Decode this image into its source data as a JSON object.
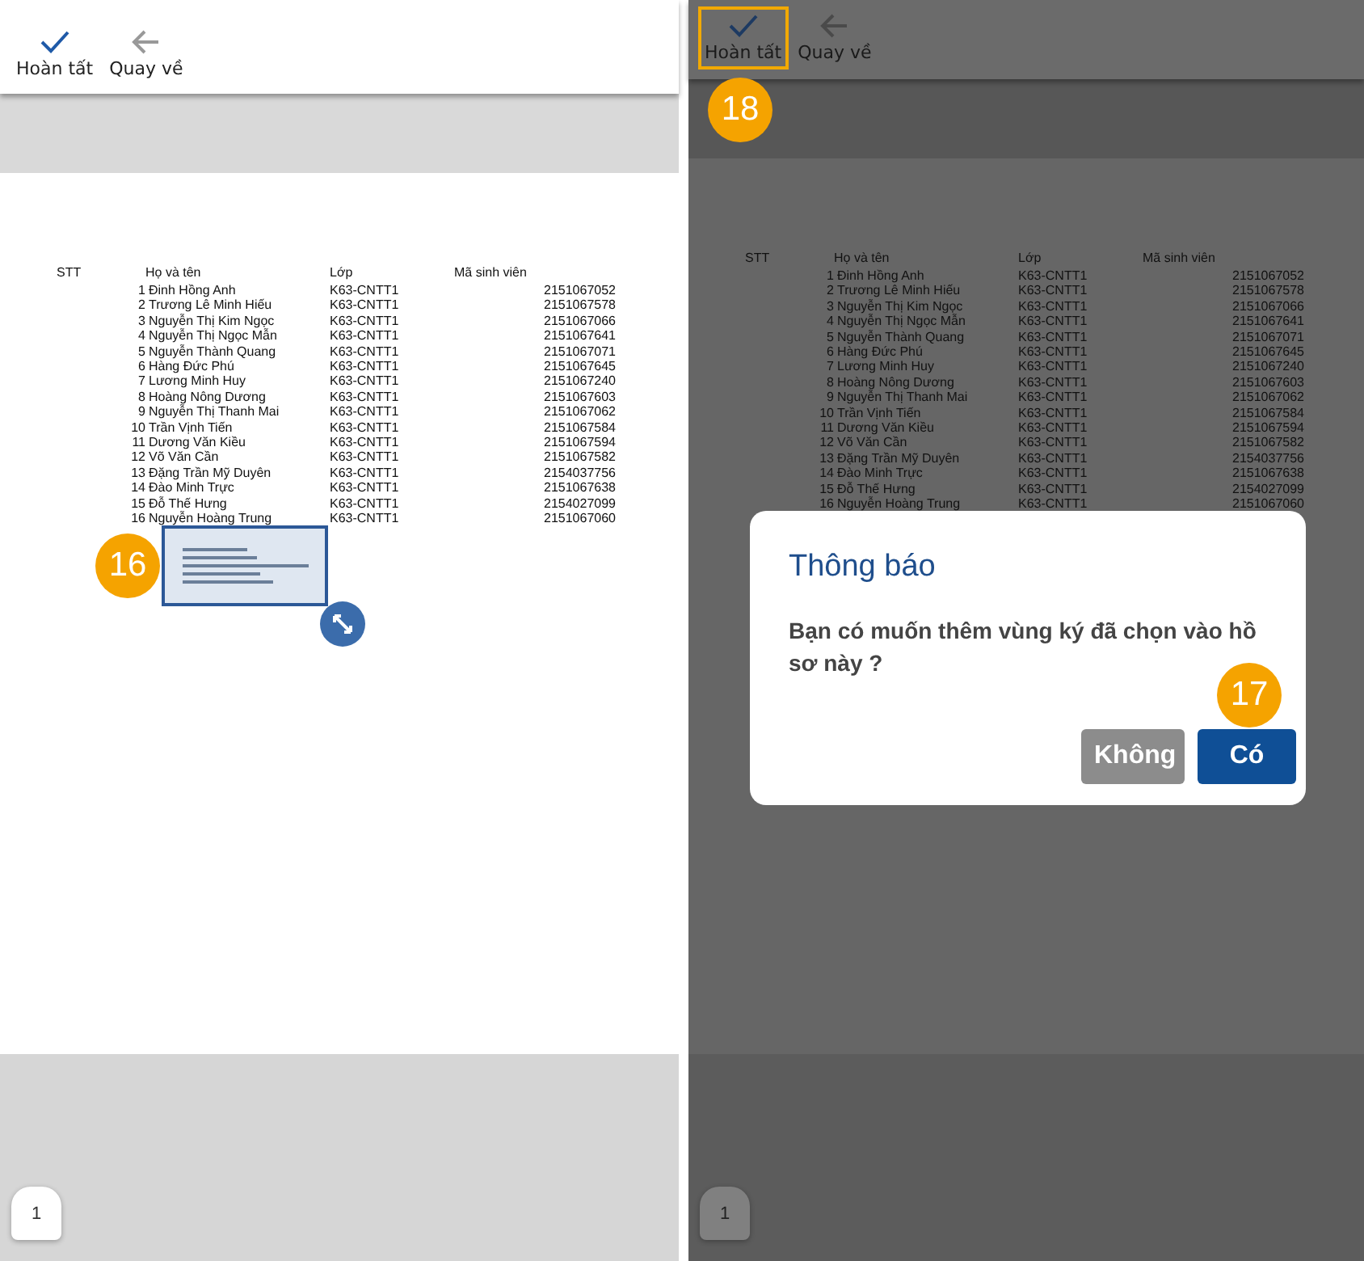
{
  "screens": [
    {
      "dimmed": false,
      "toolbar_buttons": [
        {
          "kind": "done",
          "label": "Hoàn tất",
          "highlighted": false
        },
        {
          "kind": "back",
          "label": "Quay về",
          "highlighted": false
        }
      ],
      "table": {
        "columns": [
          "STT",
          "Họ và tên",
          "Lớp",
          "Mã sinh viên"
        ],
        "rows": [
          {
            "no": "1",
            "name": "Đinh Hồng Anh",
            "class": "K63-CNTT1",
            "id": "2151067052"
          },
          {
            "no": "2",
            "name": "Trương Lê Minh Hiếu",
            "class": "K63-CNTT1",
            "id": "2151067578"
          },
          {
            "no": "3",
            "name": "Nguyễn Thị Kim Ngọc",
            "class": "K63-CNTT1",
            "id": "2151067066"
          },
          {
            "no": "4",
            "name": "Nguyễn Thị Ngọc Mẫn",
            "class": "K63-CNTT1",
            "id": "2151067641"
          },
          {
            "no": "5",
            "name": "Nguyễn Thành Quang",
            "class": "K63-CNTT1",
            "id": "2151067071"
          },
          {
            "no": "6",
            "name": "Hàng Đức Phú",
            "class": "K63-CNTT1",
            "id": "2151067645"
          },
          {
            "no": "7",
            "name": "Lương Minh Huy",
            "class": "K63-CNTT1",
            "id": "2151067240"
          },
          {
            "no": "8",
            "name": "Hoàng Nông Dương",
            "class": "K63-CNTT1",
            "id": "2151067603"
          },
          {
            "no": "9",
            "name": "Nguyễn Thị Thanh Mai",
            "class": "K63-CNTT1",
            "id": "2151067062"
          },
          {
            "no": "10",
            "name": "Trần Vịnh Tiến",
            "class": "K63-CNTT1",
            "id": "2151067584"
          },
          {
            "no": "11",
            "name": "Dương Văn Kiều",
            "class": "K63-CNTT1",
            "id": "2151067594"
          },
          {
            "no": "12",
            "name": "Võ Văn Cần",
            "class": "K63-CNTT1",
            "id": "2151067582"
          },
          {
            "no": "13",
            "name": "Đặng Trần Mỹ Duyên",
            "class": "K63-CNTT1",
            "id": "2154037756"
          },
          {
            "no": "14",
            "name": "Đào Minh Trực",
            "class": "K63-CNTT1",
            "id": "2151067638"
          },
          {
            "no": "15",
            "name": "Đỗ Thế Hưng",
            "class": "K63-CNTT1",
            "id": "2154027099"
          },
          {
            "no": "16",
            "name": "Nguyễn Hoàng Trung",
            "class": "K63-CNTT1",
            "id": "2151067060"
          }
        ]
      },
      "signature_box": {
        "step": "16"
      },
      "page_number": "1"
    },
    {
      "dimmed": true,
      "toolbar_buttons": [
        {
          "kind": "done",
          "label": "Hoàn tất",
          "highlighted": true
        },
        {
          "kind": "back",
          "label": "Quay về",
          "highlighted": false
        }
      ],
      "toolbar_step": "18",
      "table": {
        "columns": [
          "STT",
          "Họ và tên",
          "Lớp",
          "Mã sinh viên"
        ],
        "rows": [
          {
            "no": "1",
            "name": "Đinh Hồng Anh",
            "class": "K63-CNTT1",
            "id": "2151067052"
          },
          {
            "no": "2",
            "name": "Trương Lê Minh Hiếu",
            "class": "K63-CNTT1",
            "id": "2151067578"
          },
          {
            "no": "3",
            "name": "Nguyễn Thị Kim Ngọc",
            "class": "K63-CNTT1",
            "id": "2151067066"
          },
          {
            "no": "4",
            "name": "Nguyễn Thị Ngọc Mẫn",
            "class": "K63-CNTT1",
            "id": "2151067641"
          },
          {
            "no": "5",
            "name": "Nguyễn Thành Quang",
            "class": "K63-CNTT1",
            "id": "2151067071"
          },
          {
            "no": "6",
            "name": "Hàng Đức Phú",
            "class": "K63-CNTT1",
            "id": "2151067645"
          },
          {
            "no": "7",
            "name": "Lương Minh Huy",
            "class": "K63-CNTT1",
            "id": "2151067240"
          },
          {
            "no": "8",
            "name": "Hoàng Nông Dương",
            "class": "K63-CNTT1",
            "id": "2151067603"
          },
          {
            "no": "9",
            "name": "Nguyễn Thị Thanh Mai",
            "class": "K63-CNTT1",
            "id": "2151067062"
          },
          {
            "no": "10",
            "name": "Trần Vịnh Tiến",
            "class": "K63-CNTT1",
            "id": "2151067584"
          },
          {
            "no": "11",
            "name": "Dương Văn Kiều",
            "class": "K63-CNTT1",
            "id": "2151067594"
          },
          {
            "no": "12",
            "name": "Võ Văn Cần",
            "class": "K63-CNTT1",
            "id": "2151067582"
          },
          {
            "no": "13",
            "name": "Đặng Trần Mỹ Duyên",
            "class": "K63-CNTT1",
            "id": "2154037756"
          },
          {
            "no": "14",
            "name": "Đào Minh Trực",
            "class": "K63-CNTT1",
            "id": "2151067638"
          },
          {
            "no": "15",
            "name": "Đỗ Thế Hưng",
            "class": "K63-CNTT1",
            "id": "2154027099"
          },
          {
            "no": "16",
            "name": "Nguyễn Hoàng Trung",
            "class": "K63-CNTT1",
            "id": "2151067060"
          }
        ]
      },
      "dialog": {
        "title": "Thông báo",
        "message": "Bạn có muốn thêm vùng ký đã chọn vào hồ sơ này ?",
        "step": "17",
        "buttons": [
          {
            "kind": "secondary",
            "label": "Không"
          },
          {
            "kind": "primary",
            "label": "Có"
          }
        ]
      },
      "page_number": "1"
    }
  ]
}
